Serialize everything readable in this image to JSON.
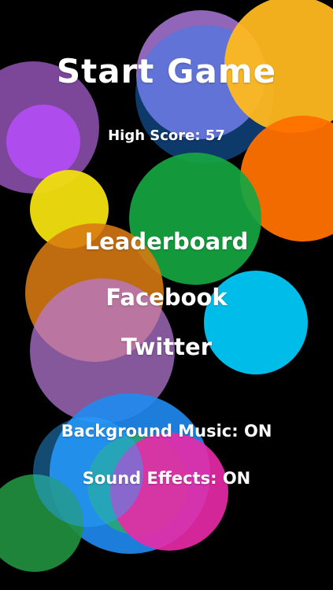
{
  "menu": {
    "title": "Start Game",
    "high_score": "High Score: 57",
    "leaderboard": "Leaderboard",
    "facebook": "Facebook",
    "twitter": "Twitter",
    "background_music": "Background Music: ON",
    "sound_effects": "Sound Effects: ON"
  },
  "colors": {
    "background": "#000000",
    "text": "#ffffff",
    "purple": "#b07bd6",
    "violet": "#b24df2",
    "yellow": "#f2df10",
    "amber": "#ffb81f",
    "orange": "#ff7100",
    "green": "#15a641",
    "cyan": "#00c6f5",
    "blue": "#1f8cf2",
    "magenta": "#ea2aa9",
    "dark_green": "#1f8f3f"
  }
}
